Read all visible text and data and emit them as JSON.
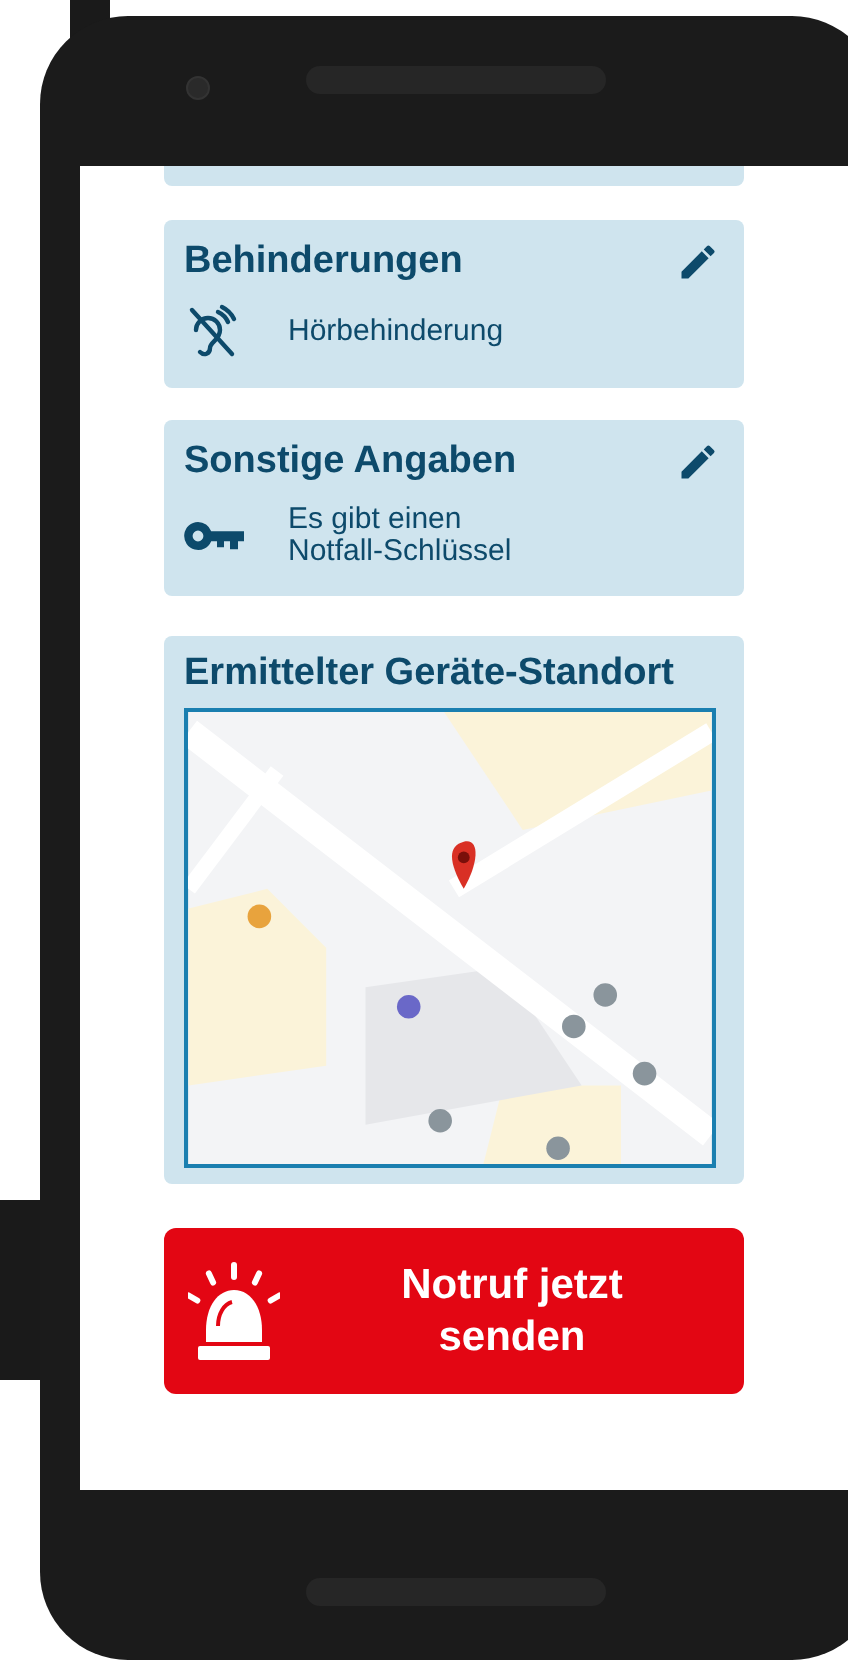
{
  "cards": [
    {
      "kind": "hearing-off",
      "title": "Behinderungen",
      "text": "Hörbehinderung"
    },
    {
      "kind": "key",
      "title": "Sonstige Angaben",
      "text": "Es gibt einen\nNotfall-Schlüssel"
    }
  ],
  "location": {
    "title": "Ermittelter Geräte-Standort"
  },
  "emergency_button": {
    "label": "Notruf jetzt\nsenden"
  }
}
